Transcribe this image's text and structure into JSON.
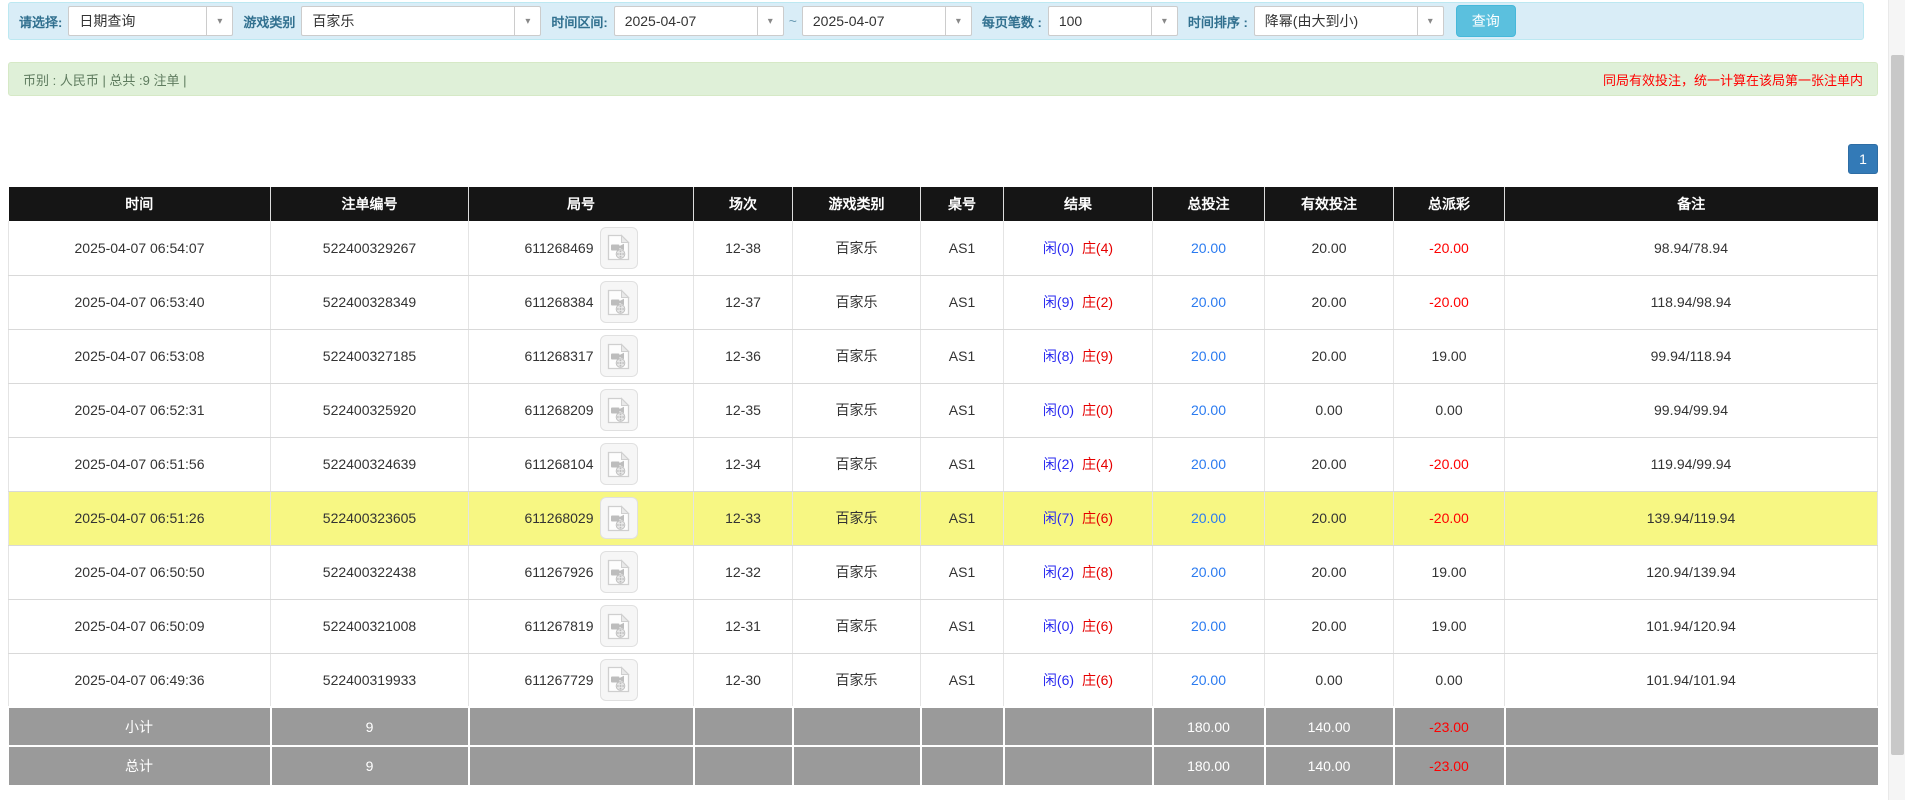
{
  "colors": {
    "filter_bar_bg": "#d9edf7",
    "label_blue": "#31708f",
    "accent_blue": "#5bc0de",
    "summary_bar_bg": "#dff0d8",
    "summary_text": "#5f7c5f",
    "red": "#ff0000",
    "pagination_blue": "#337ab7",
    "header_bg": "#151515",
    "footer_bg": "#9a9a9a",
    "highlight_yellow": "#f7f783",
    "player_blue": "#2a2af0",
    "banker_red": "#e60000",
    "amount_blue": "#2b7bf0"
  },
  "icons": {
    "select_caret": "▾"
  },
  "filters": {
    "select_label": "请选择:",
    "select_value": "日期查询",
    "game_label": "游戏类别",
    "game_value": "百家乐",
    "range_label": "时间区间:",
    "range_from": "2025-04-07",
    "range_tilde": "~",
    "range_to": "2025-04-07",
    "per_page_label": "每页笔数 :",
    "per_page_value": "100",
    "sort_label": "时间排序 :",
    "sort_value": "降幂(由大到小)",
    "query_button": "查询"
  },
  "summary": {
    "left_text": "币别 : 人民币 | 总共 :9 注单 |",
    "right_text": "同局有效投注，统一计算在该局第一张注单内"
  },
  "pagination": {
    "page": "1"
  },
  "table": {
    "headers": [
      "时间",
      "注单编号",
      "局号",
      "场次",
      "游戏类别",
      "桌号",
      "结果",
      "总投注",
      "有效投注",
      "总派彩",
      "备注"
    ],
    "rows": [
      {
        "time": "2025-04-07 06:54:07",
        "bet_id": "522400329267",
        "round": "611268469",
        "session": "12-38",
        "game": "百家乐",
        "table_no": "AS1",
        "result_player": "闲(0)",
        "result_banker": "庄(4)",
        "total_bet": "20.00",
        "valid_bet": "20.00",
        "payout": "-20.00",
        "remark": "98.94/78.94",
        "highlight": false
      },
      {
        "time": "2025-04-07 06:53:40",
        "bet_id": "522400328349",
        "round": "611268384",
        "session": "12-37",
        "game": "百家乐",
        "table_no": "AS1",
        "result_player": "闲(9)",
        "result_banker": "庄(2)",
        "total_bet": "20.00",
        "valid_bet": "20.00",
        "payout": "-20.00",
        "remark": "118.94/98.94",
        "highlight": false
      },
      {
        "time": "2025-04-07 06:53:08",
        "bet_id": "522400327185",
        "round": "611268317",
        "session": "12-36",
        "game": "百家乐",
        "table_no": "AS1",
        "result_player": "闲(8)",
        "result_banker": "庄(9)",
        "total_bet": "20.00",
        "valid_bet": "20.00",
        "payout": "19.00",
        "remark": "99.94/118.94",
        "highlight": false
      },
      {
        "time": "2025-04-07 06:52:31",
        "bet_id": "522400325920",
        "round": "611268209",
        "session": "12-35",
        "game": "百家乐",
        "table_no": "AS1",
        "result_player": "闲(0)",
        "result_banker": "庄(0)",
        "total_bet": "20.00",
        "valid_bet": "0.00",
        "payout": "0.00",
        "remark": "99.94/99.94",
        "highlight": false
      },
      {
        "time": "2025-04-07 06:51:56",
        "bet_id": "522400324639",
        "round": "611268104",
        "session": "12-34",
        "game": "百家乐",
        "table_no": "AS1",
        "result_player": "闲(2)",
        "result_banker": "庄(4)",
        "total_bet": "20.00",
        "valid_bet": "20.00",
        "payout": "-20.00",
        "remark": "119.94/99.94",
        "highlight": false
      },
      {
        "time": "2025-04-07 06:51:26",
        "bet_id": "522400323605",
        "round": "611268029",
        "session": "12-33",
        "game": "百家乐",
        "table_no": "AS1",
        "result_player": "闲(7)",
        "result_banker": "庄(6)",
        "total_bet": "20.00",
        "valid_bet": "20.00",
        "payout": "-20.00",
        "remark": "139.94/119.94",
        "highlight": true
      },
      {
        "time": "2025-04-07 06:50:50",
        "bet_id": "522400322438",
        "round": "611267926",
        "session": "12-32",
        "game": "百家乐",
        "table_no": "AS1",
        "result_player": "闲(2)",
        "result_banker": "庄(8)",
        "total_bet": "20.00",
        "valid_bet": "20.00",
        "payout": "19.00",
        "remark": "120.94/139.94",
        "highlight": false
      },
      {
        "time": "2025-04-07 06:50:09",
        "bet_id": "522400321008",
        "round": "611267819",
        "session": "12-31",
        "game": "百家乐",
        "table_no": "AS1",
        "result_player": "闲(0)",
        "result_banker": "庄(6)",
        "total_bet": "20.00",
        "valid_bet": "20.00",
        "payout": "19.00",
        "remark": "101.94/120.94",
        "highlight": false
      },
      {
        "time": "2025-04-07 06:49:36",
        "bet_id": "522400319933",
        "round": "611267729",
        "session": "12-30",
        "game": "百家乐",
        "table_no": "AS1",
        "result_player": "闲(6)",
        "result_banker": "庄(6)",
        "total_bet": "20.00",
        "valid_bet": "0.00",
        "payout": "0.00",
        "remark": "101.94/101.94",
        "highlight": false
      }
    ],
    "footer": [
      {
        "label": "小计",
        "count": "9",
        "total_bet": "180.00",
        "valid_bet": "140.00",
        "payout": "-23.00"
      },
      {
        "label": "总计",
        "count": "9",
        "total_bet": "180.00",
        "valid_bet": "140.00",
        "payout": "-23.00"
      }
    ]
  }
}
